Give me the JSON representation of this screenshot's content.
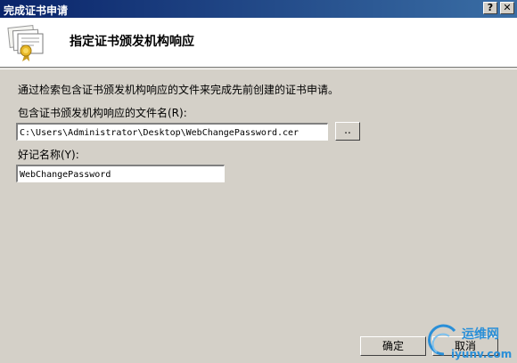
{
  "window": {
    "title": "完成证书申请",
    "help_label": "?",
    "close_label": "✕"
  },
  "header": {
    "title": "指定证书颁发机构响应",
    "icon": "certificate-icon"
  },
  "content": {
    "instruction": "通过检索包含证书颁发机构响应的文件来完成先前创建的证书申请。",
    "file_label": "包含证书颁发机构响应的文件名(R):",
    "file_value": "C:\\Users\\Administrator\\Desktop\\WebChangePassword.cer",
    "browse_label": "..",
    "friendly_label": "好记名称(Y):",
    "friendly_value": "WebChangePassword"
  },
  "footer": {
    "ok_label": "确定",
    "cancel_label": "取消"
  },
  "watermark": {
    "text_cn": "运维网",
    "text_url": "iyunv.com"
  },
  "colors": {
    "title_bar": "#0a246a",
    "dialog_bg": "#d4d0c8",
    "watermark": "#2a8fd8"
  }
}
